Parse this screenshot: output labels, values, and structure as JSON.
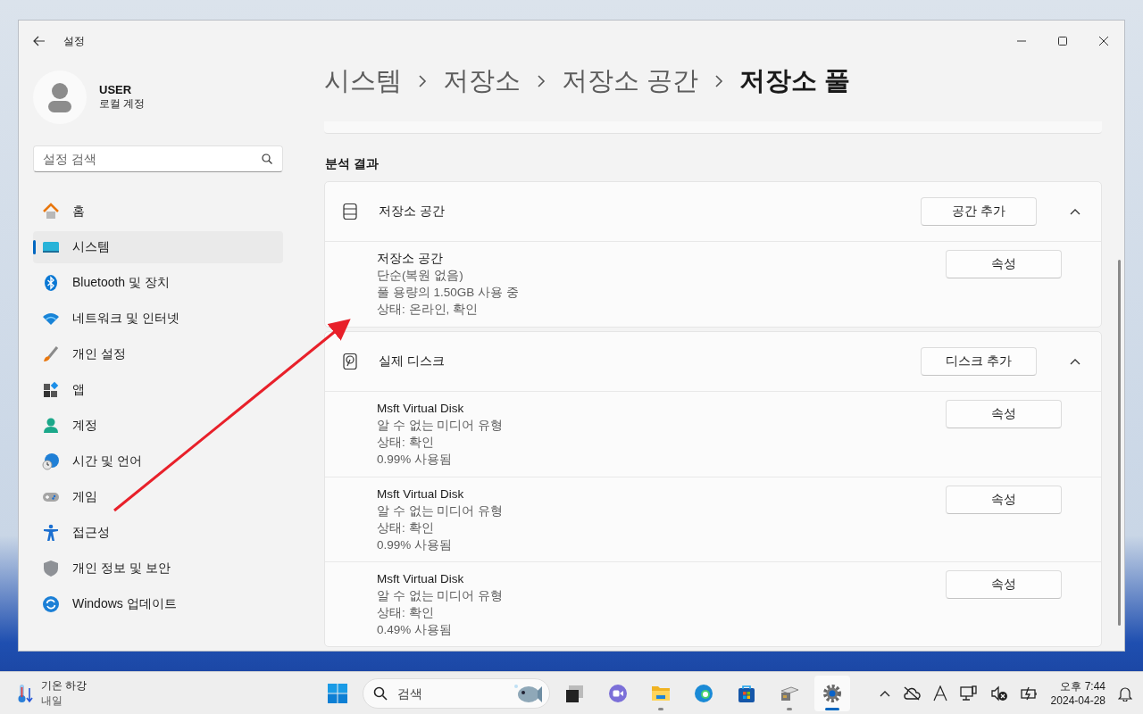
{
  "window": {
    "title": "설정"
  },
  "user": {
    "name": "USER",
    "account": "로컬 계정"
  },
  "search": {
    "placeholder": "설정 검색"
  },
  "nav": [
    {
      "kind": "home",
      "label": "홈",
      "selected": false
    },
    {
      "kind": "system",
      "label": "시스템",
      "selected": true
    },
    {
      "kind": "bluetooth",
      "label": "Bluetooth 및 장치",
      "selected": false
    },
    {
      "kind": "network",
      "label": "네트워크 및 인터넷",
      "selected": false
    },
    {
      "kind": "brush",
      "label": "개인 설정",
      "selected": false
    },
    {
      "kind": "apps",
      "label": "앱",
      "selected": false
    },
    {
      "kind": "account",
      "label": "계정",
      "selected": false
    },
    {
      "kind": "time",
      "label": "시간 및 언어",
      "selected": false
    },
    {
      "kind": "game",
      "label": "게임",
      "selected": false
    },
    {
      "kind": "access",
      "label": "접근성",
      "selected": false
    },
    {
      "kind": "shield",
      "label": "개인 정보 및 보안",
      "selected": false
    },
    {
      "kind": "update",
      "label": "Windows 업데이트",
      "selected": false
    }
  ],
  "breadcrumb": [
    "시스템",
    "저장소",
    "저장소 공간",
    "저장소 풀"
  ],
  "section_title": "분석 결과",
  "groups": [
    {
      "kind": "storage",
      "title": "저장소 공간",
      "button": "공간 추가",
      "expanded": true,
      "items": [
        {
          "lines": [
            "저장소 공간",
            "단순(복원 없음)",
            "풀 용량의 1.50GB 사용 중",
            "상태: 온라인, 확인"
          ],
          "button": "속성"
        }
      ]
    },
    {
      "kind": "disk",
      "title": "실제 디스크",
      "button": "디스크 추가",
      "expanded": true,
      "items": [
        {
          "lines": [
            "Msft Virtual Disk",
            "알 수 없는 미디어 유형",
            "상태: 확인",
            "0.99% 사용됨"
          ],
          "button": "속성"
        },
        {
          "lines": [
            "Msft Virtual Disk",
            "알 수 없는 미디어 유형",
            "상태: 확인",
            "0.99% 사용됨"
          ],
          "button": "속성"
        },
        {
          "lines": [
            "Msft Virtual Disk",
            "알 수 없는 미디어 유형",
            "상태: 확인",
            "0.49% 사용됨"
          ],
          "button": "속성"
        }
      ]
    }
  ],
  "taskbar": {
    "weather": {
      "title": "기온 하강",
      "subtitle": "내일"
    },
    "search_placeholder": "검색",
    "apps": [
      {
        "kind": "taskview",
        "running": false,
        "selected": false
      },
      {
        "kind": "meet",
        "running": false,
        "selected": false
      },
      {
        "kind": "explorer",
        "running": true,
        "selected": false
      },
      {
        "kind": "edge",
        "running": false,
        "selected": false
      },
      {
        "kind": "store",
        "running": false,
        "selected": false
      },
      {
        "kind": "tool",
        "running": true,
        "selected": false
      },
      {
        "kind": "settings",
        "running": true,
        "selected": true
      }
    ],
    "time": "오후 7:44",
    "date": "2024-04-28"
  }
}
